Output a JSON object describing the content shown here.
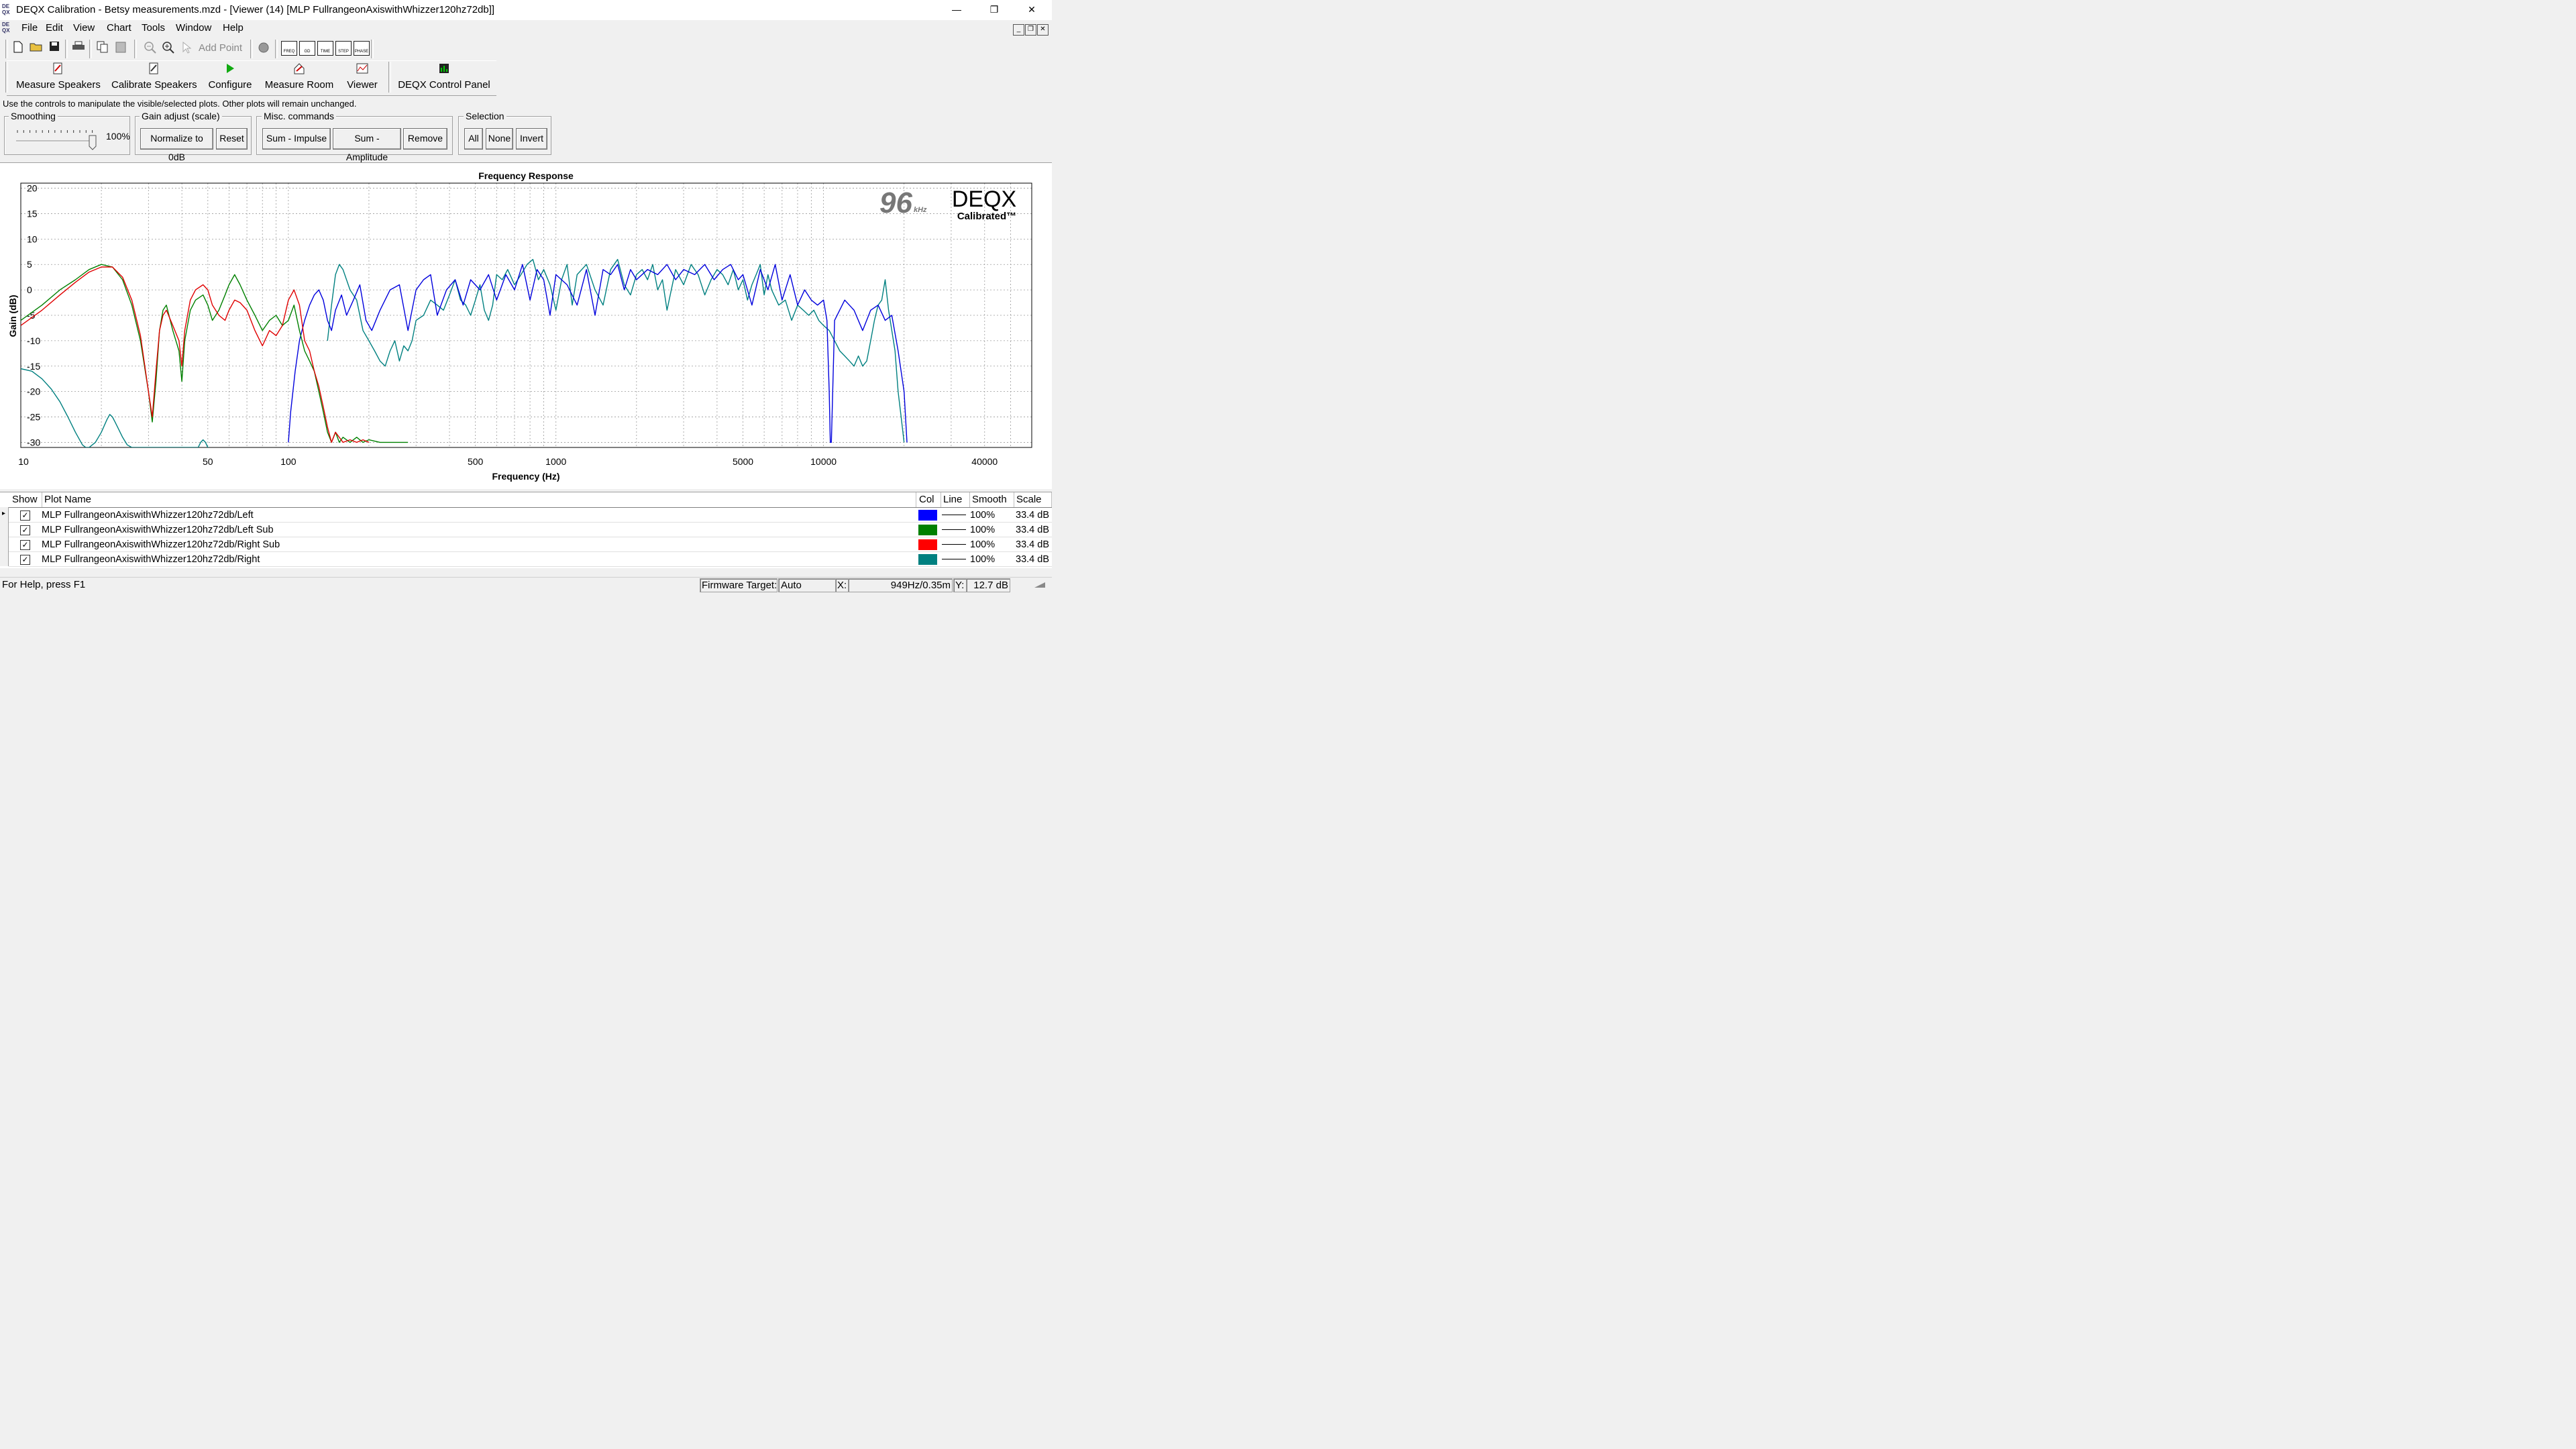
{
  "window": {
    "title": "DEQX Calibration - Betsy measurements.mzd - [Viewer (14) [MLP FullrangeonAxiswithWhizzer120hz72db]]",
    "app_icon_text": "DE QX",
    "controls": {
      "minimize": "—",
      "restore": "❐",
      "close": "✕"
    }
  },
  "menu": {
    "items": [
      "File",
      "Edit",
      "View",
      "Chart",
      "Tools",
      "Window",
      "Help"
    ],
    "mdi_controls": [
      "_",
      "❐",
      "✕"
    ]
  },
  "toolbar": {
    "add_point_label": "Add Point",
    "chart_buttons": [
      "FREQ",
      "GD",
      "TIME",
      "STEP",
      "PHASE"
    ]
  },
  "big_toolbar": [
    {
      "label": "Measure Speakers",
      "icon": "measure-speakers-icon"
    },
    {
      "label": "Calibrate Speakers",
      "icon": "calibrate-speakers-icon"
    },
    {
      "label": "Configure",
      "icon": "play-icon"
    },
    {
      "label": "Measure Room",
      "icon": "measure-room-icon"
    },
    {
      "label": "Viewer",
      "icon": "viewer-icon"
    },
    {
      "label": "DEQX Control Panel",
      "icon": "control-panel-icon"
    }
  ],
  "controls": {
    "hint": "Use the controls to manipulate the visible/selected plots.  Other plots will remain unchanged.",
    "smoothing": {
      "title": "Smoothing",
      "value": "100%",
      "level": 1.0
    },
    "gain_adjust": {
      "title": "Gain adjust (scale)",
      "normalize": "Normalize to 0dB",
      "reset": "Reset"
    },
    "misc": {
      "title": "Misc. commands",
      "sum_impulse": "Sum - Impulse",
      "sum_amplitude": "Sum - Amplitude",
      "remove": "Remove"
    },
    "selection": {
      "title": "Selection",
      "all": "All",
      "none": "None",
      "invert": "Invert"
    }
  },
  "chart_data": {
    "type": "line",
    "title": "Frequency Response",
    "xlabel": "Frequency (Hz)",
    "ylabel": "Gain (dB)",
    "x_scale": "log",
    "xlim": [
      10,
      60000
    ],
    "ylim": [
      -31,
      21
    ],
    "x_ticks": [
      10,
      50,
      100,
      500,
      1000,
      5000,
      10000,
      40000
    ],
    "y_ticks": [
      20,
      15,
      10,
      5,
      0,
      -5,
      -10,
      -15,
      -20,
      -25,
      -30
    ],
    "grid": true,
    "logo": {
      "rate": "96",
      "rate_unit": "kHz",
      "brand": "DEQX",
      "sub": "Calibrated™"
    },
    "series": [
      {
        "name": "MLP FullrangeonAxiswithWhizzer120hz72db/Left",
        "color": "#0000dd",
        "x": [
          100,
          102,
          106,
          110,
          115,
          120,
          125,
          130,
          135,
          140,
          145,
          150,
          158,
          165,
          175,
          185,
          195,
          205,
          220,
          240,
          260,
          280,
          300,
          320,
          340,
          360,
          390,
          420,
          450,
          480,
          520,
          560,
          600,
          650,
          700,
          750,
          800,
          850,
          900,
          950,
          1000,
          1100,
          1200,
          1300,
          1400,
          1500,
          1600,
          1700,
          1800,
          1900,
          2000,
          2200,
          2400,
          2600,
          2800,
          3000,
          3300,
          3600,
          3900,
          4200,
          4500,
          4800,
          5000,
          5400,
          5800,
          6200,
          6600,
          7000,
          7500,
          8000,
          8500,
          9000,
          9500,
          10000,
          10300,
          10500,
          10600,
          10700,
          11000,
          12000,
          13000,
          14000,
          15000,
          16000,
          17000,
          18000,
          19000,
          20000,
          20500
        ],
        "y": [
          -30,
          -24,
          -16,
          -10,
          -6,
          -3,
          -1,
          0,
          -2,
          -6,
          -8,
          -4,
          -1,
          -5,
          -2,
          1,
          -6,
          -8,
          -4,
          0,
          1,
          -8,
          0,
          2,
          3,
          -5,
          0,
          2,
          -3,
          2,
          0,
          3,
          -2,
          3,
          0,
          5,
          -2,
          4,
          2,
          -5,
          3,
          1,
          -3,
          4,
          -5,
          4,
          3,
          5,
          0,
          4,
          2,
          4,
          3,
          5,
          2,
          4,
          3,
          5,
          2,
          4,
          5,
          2,
          3,
          -3,
          4,
          0,
          5,
          -2,
          3,
          -3,
          0,
          -2,
          -3,
          -2,
          -6,
          -20,
          -30,
          -30,
          -6,
          -2,
          -4,
          -8,
          -4,
          -3,
          -6,
          -5,
          -12,
          -20,
          -30
        ]
      },
      {
        "name": "MLP FullrangeonAxiswithWhizzer120hz72db/Left Sub",
        "color": "#008000",
        "x": [
          10,
          12,
          14,
          16,
          18,
          20,
          22,
          24,
          26,
          28,
          30,
          31,
          32,
          33,
          34,
          35,
          37,
          39,
          40,
          41,
          43,
          45,
          48,
          50,
          52,
          55,
          58,
          60,
          63,
          66,
          70,
          75,
          80,
          85,
          90,
          95,
          100,
          105,
          110,
          115,
          120,
          125,
          130,
          135,
          140,
          145,
          150,
          155,
          160,
          170,
          180,
          190,
          200,
          220,
          240,
          260,
          280
        ],
        "y": [
          -6,
          -3,
          0,
          2,
          4,
          5,
          4.5,
          2,
          -3,
          -10,
          -20,
          -26,
          -18,
          -8,
          -4,
          -3,
          -8,
          -12,
          -18,
          -10,
          -4,
          -2,
          -1,
          -3,
          -6,
          -4,
          -1,
          1,
          3,
          1,
          -2,
          -5,
          -8,
          -6,
          -5,
          -7,
          -6,
          -3,
          -8,
          -12,
          -14,
          -16,
          -20,
          -24,
          -28,
          -30,
          -28,
          -30,
          -29,
          -30,
          -29,
          -30,
          -29.5,
          -30,
          -30,
          -30,
          -30
        ]
      },
      {
        "name": "MLP FullrangeonAxiswithWhizzer120hz72db/Right Sub",
        "color": "#e00000",
        "x": [
          10,
          12,
          14,
          16,
          18,
          20,
          22,
          24,
          26,
          28,
          30,
          31,
          32,
          33,
          34,
          35,
          37,
          39,
          40,
          41,
          43,
          45,
          48,
          50,
          52,
          55,
          58,
          60,
          63,
          66,
          70,
          75,
          80,
          85,
          90,
          95,
          100,
          105,
          110,
          115,
          120,
          125,
          130,
          135,
          140,
          145,
          150,
          160,
          170,
          180,
          190,
          200
        ],
        "y": [
          -7,
          -4,
          -1,
          1.5,
          3.5,
          4.5,
          4.5,
          2.5,
          -2,
          -9,
          -20,
          -25,
          -16,
          -8,
          -5,
          -4,
          -7,
          -10,
          -15,
          -8,
          -2,
          0,
          1,
          0,
          -3,
          -5,
          -6,
          -4,
          -2,
          -2.5,
          -4,
          -8,
          -11,
          -8,
          -9,
          -7,
          -2,
          0,
          -3,
          -10,
          -12,
          -16,
          -19,
          -23,
          -27,
          -30,
          -28,
          -30,
          -29.5,
          -30,
          -29.5,
          -30
        ]
      },
      {
        "name": "MLP FullrangeonAxiswithWhizzer120hz72db/Right",
        "color": "#008080",
        "x": [
          10,
          11,
          12,
          13,
          14,
          15,
          16,
          17,
          17.5,
          18,
          19,
          19.5,
          20,
          21,
          21.5,
          22,
          22.5,
          23,
          24,
          25,
          26,
          27,
          28,
          28.5,
          29,
          30,
          31,
          32,
          33,
          34,
          35,
          36,
          37,
          38,
          39,
          40,
          42,
          44,
          46,
          47,
          48,
          49,
          50,
          50.5
        ],
        "y": [
          -15.5,
          -16,
          -17.5,
          -19.5,
          -22,
          -25,
          -28,
          -30.5,
          -31,
          -31,
          -30,
          -29,
          -28,
          -25.5,
          -24.5,
          -25,
          -26,
          -27,
          -29,
          -30.5,
          -31,
          -31,
          -31,
          -31,
          -31,
          -31,
          -31,
          -31,
          -31,
          -31,
          -31,
          -31,
          -31,
          -31,
          -31,
          -31,
          -31,
          -31,
          -31,
          -30,
          -29.5,
          -30,
          -31,
          -31
        ],
        "x2": [
          140,
          145,
          150,
          155,
          160,
          170,
          180,
          190,
          200,
          210,
          220,
          230,
          240,
          250,
          260,
          270,
          280,
          290,
          300,
          320,
          340,
          360,
          380,
          400,
          420,
          440,
          460,
          480,
          500,
          520,
          540,
          560,
          580,
          600,
          630,
          660,
          700,
          740,
          780,
          820,
          860,
          900,
          950,
          1000,
          1050,
          1100,
          1150,
          1200,
          1300,
          1400,
          1500,
          1600,
          1700,
          1800,
          1900,
          2000,
          2100,
          2200,
          2300,
          2400,
          2500,
          2600,
          2800,
          3000,
          3200,
          3400,
          3600,
          3800,
          4000,
          4200,
          4400,
          4600,
          4800,
          5000,
          5200,
          5400,
          5600,
          5800,
          6000,
          6200,
          6400,
          6800,
          7200,
          7600,
          8000,
          8400,
          8800,
          9200,
          9600,
          10000,
          10500,
          11000,
          11500,
          12000,
          12500,
          13000,
          13500,
          14000,
          14500,
          15000,
          15500,
          16000,
          16500,
          17000,
          17500,
          18000,
          18500,
          19000,
          19500,
          20000
        ],
        "y2": [
          -10,
          -3,
          3,
          5,
          4,
          0,
          -2,
          -8,
          -10,
          -12,
          -14,
          -15,
          -12,
          -10,
          -14,
          -11,
          -12,
          -10,
          -6,
          -5,
          -2,
          -3,
          -4,
          -1,
          2,
          -2,
          -3,
          -5,
          -2,
          1,
          -4,
          -6,
          -3,
          3,
          2,
          4,
          1,
          3,
          5,
          6,
          2,
          4,
          1,
          -4,
          2,
          5,
          -3,
          3,
          5,
          0,
          -3,
          4,
          6,
          1,
          -1,
          3,
          4,
          2,
          5,
          0,
          2,
          -4,
          4,
          1,
          5,
          3,
          -1,
          2,
          4,
          3,
          1,
          4,
          0,
          2,
          -2,
          1,
          3,
          5,
          -1,
          3,
          0,
          -3,
          -2,
          -6,
          -3,
          -4,
          -5,
          -4,
          -6,
          -7,
          -8,
          -10,
          -12,
          -13,
          -14,
          -15,
          -13,
          -15,
          -14,
          -10,
          -6,
          -3,
          -2,
          2,
          -4,
          -8,
          -12,
          -20,
          -25,
          -30
        ]
      }
    ]
  },
  "table": {
    "headers": {
      "show": "Show",
      "plot_name": "Plot Name",
      "col": "Col",
      "line": "Line",
      "smooth": "Smooth",
      "scale": "Scale"
    },
    "rows": [
      {
        "checked": "✓",
        "name": "MLP FullrangeonAxiswithWhizzer120hz72db/Left",
        "color": "#0000ff",
        "smooth": "100%",
        "scale": "33.4 dB"
      },
      {
        "checked": "✓",
        "name": "MLP FullrangeonAxiswithWhizzer120hz72db/Left Sub",
        "color": "#008000",
        "smooth": "100%",
        "scale": "33.4 dB"
      },
      {
        "checked": "✓",
        "name": "MLP FullrangeonAxiswithWhizzer120hz72db/Right Sub",
        "color": "#ff0000",
        "smooth": "100%",
        "scale": "33.4 dB"
      },
      {
        "checked": "✓",
        "name": "MLP FullrangeonAxiswithWhizzer120hz72db/Right",
        "color": "#008080",
        "smooth": "100%",
        "scale": "33.4 dB"
      }
    ]
  },
  "status": {
    "help": "For Help, press F1",
    "firmware_label": "Firmware Target:",
    "firmware_value": "Auto",
    "x_label": "X:",
    "x_value": "949Hz/0.35m",
    "y_label": "Y:",
    "y_value": "12.7 dB"
  }
}
